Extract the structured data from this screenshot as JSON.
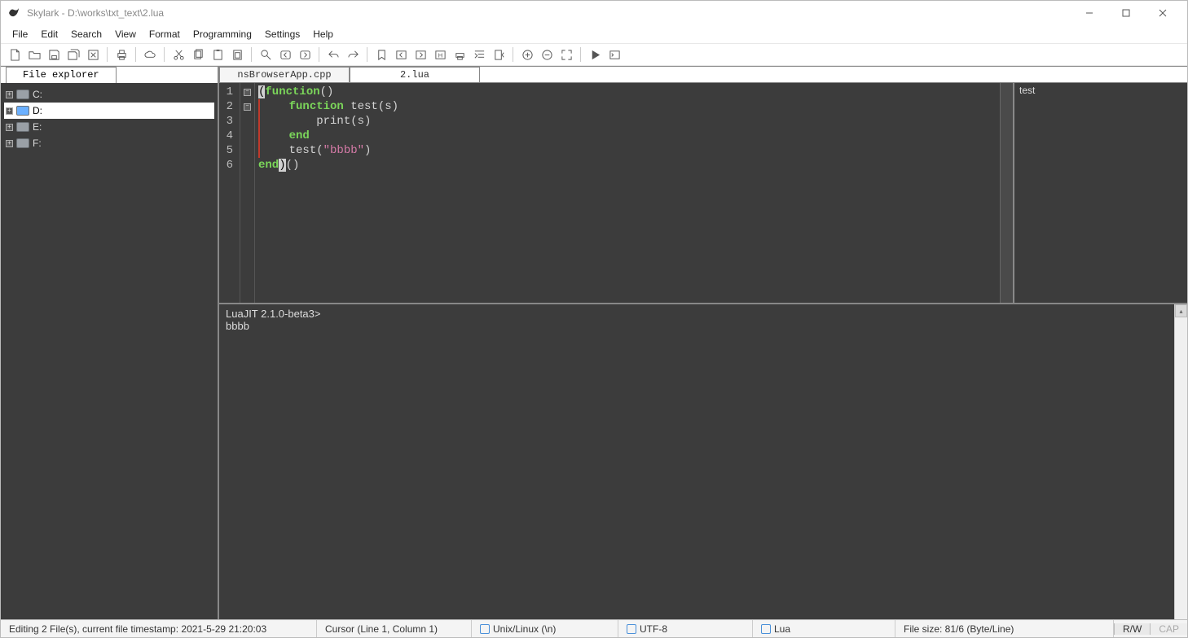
{
  "window": {
    "title": "Skylark - D:\\works\\txt_text\\2.lua"
  },
  "menu": {
    "items": [
      "File",
      "Edit",
      "Search",
      "View",
      "Format",
      "Programming",
      "Settings",
      "Help"
    ]
  },
  "toolbar_icons": [
    "new-file-icon",
    "open-file-icon",
    "save-icon",
    "save-all-icon",
    "close-file-icon",
    "|",
    "print-icon",
    "|",
    "cloud-icon",
    "|",
    "cut-icon",
    "copy-icon",
    "paste-icon",
    "clipboard-icon",
    "|",
    "find-icon",
    "find-prev-icon",
    "find-next-icon",
    "|",
    "undo-icon",
    "redo-icon",
    "|",
    "bookmark-icon",
    "goto-prev-icon",
    "goto-next-icon",
    "highlight-icon",
    "printer-icon",
    "indent-icon",
    "dedent-icon",
    "|",
    "zoom-in-icon",
    "zoom-out-icon",
    "fullscreen-icon",
    "|",
    "run-icon",
    "terminal-icon"
  ],
  "sidebar": {
    "tab_label": "File explorer",
    "drives": [
      {
        "label": "C:",
        "selected": false
      },
      {
        "label": "D:",
        "selected": true
      },
      {
        "label": "E:",
        "selected": false
      },
      {
        "label": "F:",
        "selected": false
      }
    ]
  },
  "tabs": [
    {
      "label": "nsBrowserApp.cpp",
      "active": false
    },
    {
      "label": "2.lua",
      "active": true
    }
  ],
  "editor": {
    "line_numbers": [
      "1",
      "2",
      "3",
      "4",
      "5",
      "6"
    ],
    "lines": [
      {
        "indent": "",
        "tokens": [
          [
            "paren-hl",
            "("
          ],
          [
            "kw",
            "function"
          ],
          [
            "fn",
            "()"
          ]
        ]
      },
      {
        "indent": "    ",
        "tokens": [
          [
            "kw",
            "function"
          ],
          [
            "fn",
            " test(s)"
          ]
        ]
      },
      {
        "indent": "        ",
        "tokens": [
          [
            "fn",
            "print(s)"
          ]
        ]
      },
      {
        "indent": "    ",
        "tokens": [
          [
            "kw",
            "end"
          ]
        ]
      },
      {
        "indent": "    ",
        "tokens": [
          [
            "fn",
            "test("
          ],
          [
            "str",
            "\"bbbb\""
          ],
          [
            "fn",
            ")"
          ]
        ]
      },
      {
        "indent": "",
        "tokens": [
          [
            "kw",
            "end"
          ],
          [
            "paren-hl",
            ")"
          ],
          [
            "fn",
            "()"
          ]
        ]
      }
    ]
  },
  "outline": {
    "items": [
      "test"
    ]
  },
  "console": {
    "lines": [
      "LuaJIT 2.1.0-beta3>",
      "bbbb"
    ]
  },
  "status": {
    "editing": "Editing 2 File(s), current file timestamp: 2021-5-29 21:20:03",
    "cursor": "Cursor (Line 1, Column 1)",
    "eol": "Unix/Linux (\\n)",
    "encoding": "UTF-8",
    "lang": "Lua",
    "size": "File size: 81/6 (Byte/Line)",
    "rw": "R/W",
    "cap": "CAP"
  }
}
